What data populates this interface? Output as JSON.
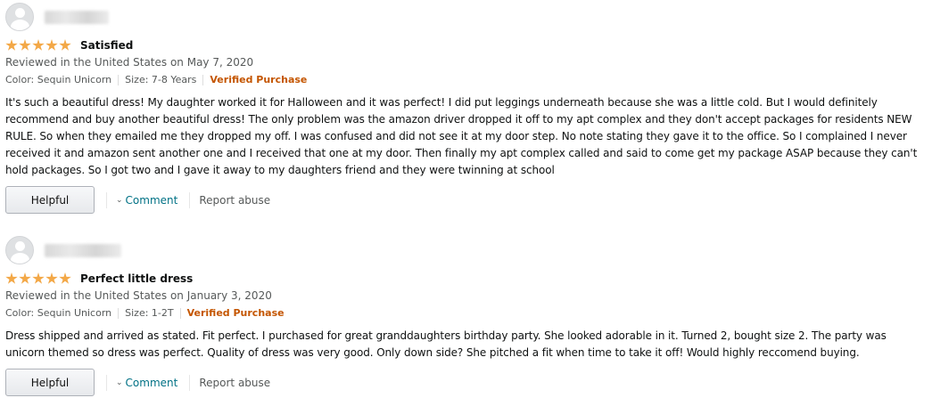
{
  "reviews": [
    {
      "title": "Satisfied",
      "reviewed_in": "Reviewed in the United States on May 7, 2020",
      "color": "Color: Sequin Unicorn",
      "size": "Size: 7-8 Years",
      "verified": "Verified Purchase",
      "rating": 5,
      "body": "It's such a beautiful dress! My daughter worked it for Halloween and it was perfect! I did put leggings underneath because she was a little cold. But I would definitely recommend and buy another beautiful dress! The only problem was the amazon driver dropped it off to my apt complex and they don't accept packages for residents NEW RULE. So when they emailed me they dropped my off. I was confused and did not see it at my door step. No note stating they gave it to the office. So I complained I never received it and amazon sent another one and I received that one at my door. Then finally my apt complex called and said to come get my package ASAP because they can't hold packages. So I got two and I gave it away to my daughters friend and they were twinning at school",
      "helpful_label": "Helpful",
      "comment_label": "Comment",
      "report_label": "Report abuse"
    },
    {
      "title": "Perfect little dress",
      "reviewed_in": "Reviewed in the United States on January 3, 2020",
      "color": "Color: Sequin Unicorn",
      "size": "Size: 1-2T",
      "verified": "Verified Purchase",
      "rating": 5,
      "body": "Dress shipped and arrived as stated. Fit perfect. I purchased for great granddaughters birthday party. She looked adorable in it. Turned 2, bought size 2. The party was unicorn themed so dress was perfect. Quality of dress was very good. Only down side? She pitched a fit when time to take it off! Would highly reccomend buying.",
      "helpful_label": "Helpful",
      "comment_label": "Comment",
      "report_label": "Report abuse"
    }
  ],
  "colors": {
    "star": "#f3a847",
    "verified": "#c45500",
    "link": "#007185",
    "muted": "#565959"
  }
}
